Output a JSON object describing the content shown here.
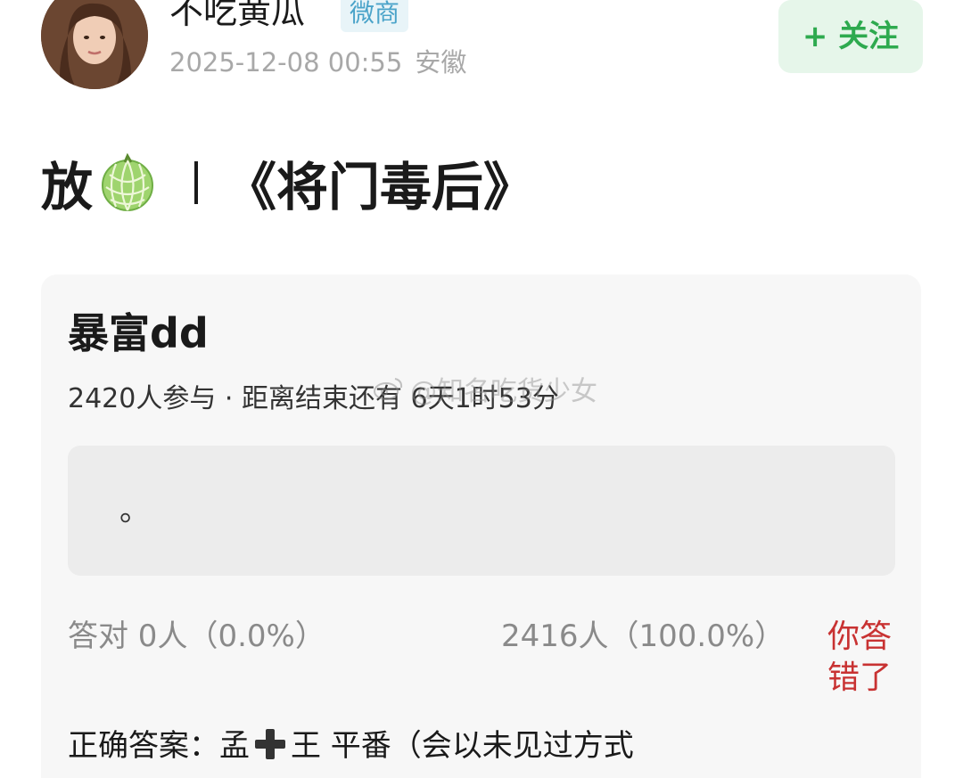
{
  "post": {
    "author": "不吃黄瓜",
    "badge": "微商",
    "timestamp": "2025-12-08 00:55",
    "location": "安徽",
    "follow_label": "+ 关注",
    "title_prefix": "放",
    "title_icon": "melon-icon",
    "title_book": "《将门毒后》"
  },
  "quiz": {
    "title": "暴富dd",
    "stats": "2420人参与 · 距离结束还有 6天1时53分",
    "option_text": "。",
    "correct_result": "答对  0人（0.0%）",
    "wrong_result": "2416人（100.0%）",
    "wrong_flag": "你答错了",
    "answer_prefix": "正确答案：孟",
    "answer_suffix": "王 平番（会以未见过方式",
    "answer_icon": "plus-icon"
  },
  "watermark": {
    "text": "@知名吃货少女",
    "icon": "weibo-icon"
  },
  "colors": {
    "follow_green": "#2eaa4f",
    "badge_blue": "#4aa3c9",
    "wrong_red": "#c83232",
    "card_bg": "#f7f7f7"
  }
}
